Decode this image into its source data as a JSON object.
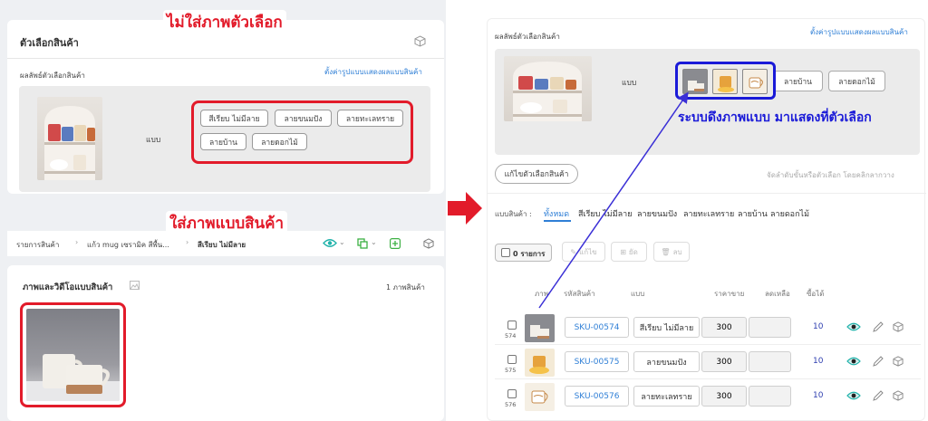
{
  "callouts": {
    "no_option_image": "ไม่ใส่ภาพตัวเลือก",
    "add_product_image": "ใส่ภาพแบบสินค้า",
    "system_pull": "ระบบดึงภาพแบบ มาแสดงที่ตัวเลือก"
  },
  "left_top": {
    "title": "ตัวเลือกสินค้า",
    "section_label": "ผลลัพธ์ตัวเลือกสินค้า",
    "settings_link": "ตั้งค่ารูปแบบแสดงผลแบบสินค้า",
    "variant_label": "แบบ",
    "variants": [
      "สีเรียบ ไม่มีลาย",
      "ลายขนมปัง",
      "ลายทะเลทราย",
      "ลายบ้าน",
      "ลายดอกไม้"
    ]
  },
  "left_bottom": {
    "breadcrumb": [
      "รายการสินค้า",
      "แก้ว mug เซรามิค สีพื้น...",
      "สีเรียบ ไม่มีลาย"
    ],
    "media_title": "ภาพและวิดีโอแบบสินค้า",
    "media_count": "1 ภาพสินค้า"
  },
  "right": {
    "section_label": "ผลลัพธ์ตัวเลือกสินค้า",
    "settings_link": "ตั้งค่ารูปแบบแสดงผลแบบสินค้า",
    "variant_label": "แบบ",
    "chips": [
      "ลายบ้าน",
      "ลายดอกไม้"
    ],
    "edit_button": "แก้ไขตัวเลือกสินค้า",
    "reorder_hint": "จัดลำดับขั้นหรือตัวเลือก โดยคลิกลากวาง",
    "filter_label": "แบบสินค้า :",
    "filter_tabs": [
      "ทั้งหมด",
      "สีเรียบ ไม่มีลาย",
      "ลายขนมปัง",
      "ลายทะเลทราย",
      "ลายบ้าน",
      "ลายดอกไม้"
    ],
    "selected_count": "0 รายการ",
    "bulk_actions": [
      "แก้ไข",
      "ยัด",
      "ลบ"
    ],
    "columns": [
      "ภาพ",
      "รหัสสินค้า",
      "แบบ",
      "ราคาขาย",
      "ลดเหลือ",
      "ซื้อได้"
    ],
    "rows": [
      {
        "num": "574",
        "sku": "SKU-00574",
        "variant": "สีเรียบ ไม่มีลาย",
        "price": "300",
        "qty": "10"
      },
      {
        "num": "575",
        "sku": "SKU-00575",
        "variant": "ลายขนมปัง",
        "price": "300",
        "qty": "10"
      },
      {
        "num": "576",
        "sku": "SKU-00576",
        "variant": "ลายทะเลทราย",
        "price": "300",
        "qty": "10"
      }
    ]
  },
  "colors": {
    "red": "#e21b2a",
    "blue": "#1a1ad8",
    "link": "#2f7fd6"
  }
}
